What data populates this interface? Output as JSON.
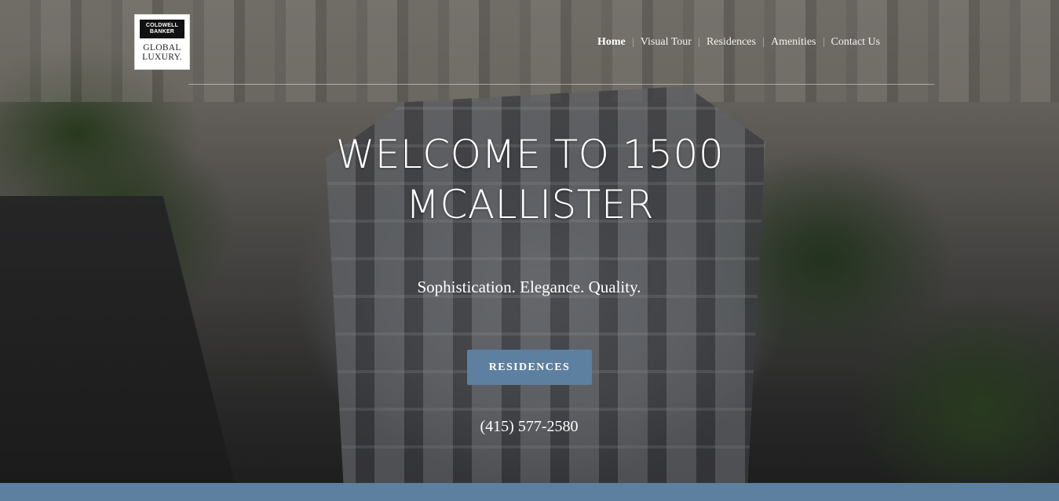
{
  "logo": {
    "brand_line1": "COLDWELL",
    "brand_line2": "BANKER",
    "sub_line1": "GLOBAL",
    "sub_line2": "LUXURY."
  },
  "nav": {
    "items": [
      {
        "label": "Home",
        "active": true
      },
      {
        "label": "Visual Tour",
        "active": false
      },
      {
        "label": "Residences",
        "active": false
      },
      {
        "label": "Amenities",
        "active": false
      },
      {
        "label": "Contact Us",
        "active": false
      }
    ]
  },
  "hero": {
    "title_line1": "WELCOME TO 1500",
    "title_line2": "MCALLISTER",
    "tagline": "Sophistication. Elegance. Quality.",
    "cta_label": "RESIDENCES",
    "phone": "(415) 577-2580"
  },
  "colors": {
    "accent": "#5d80a0",
    "text": "#ffffff"
  }
}
